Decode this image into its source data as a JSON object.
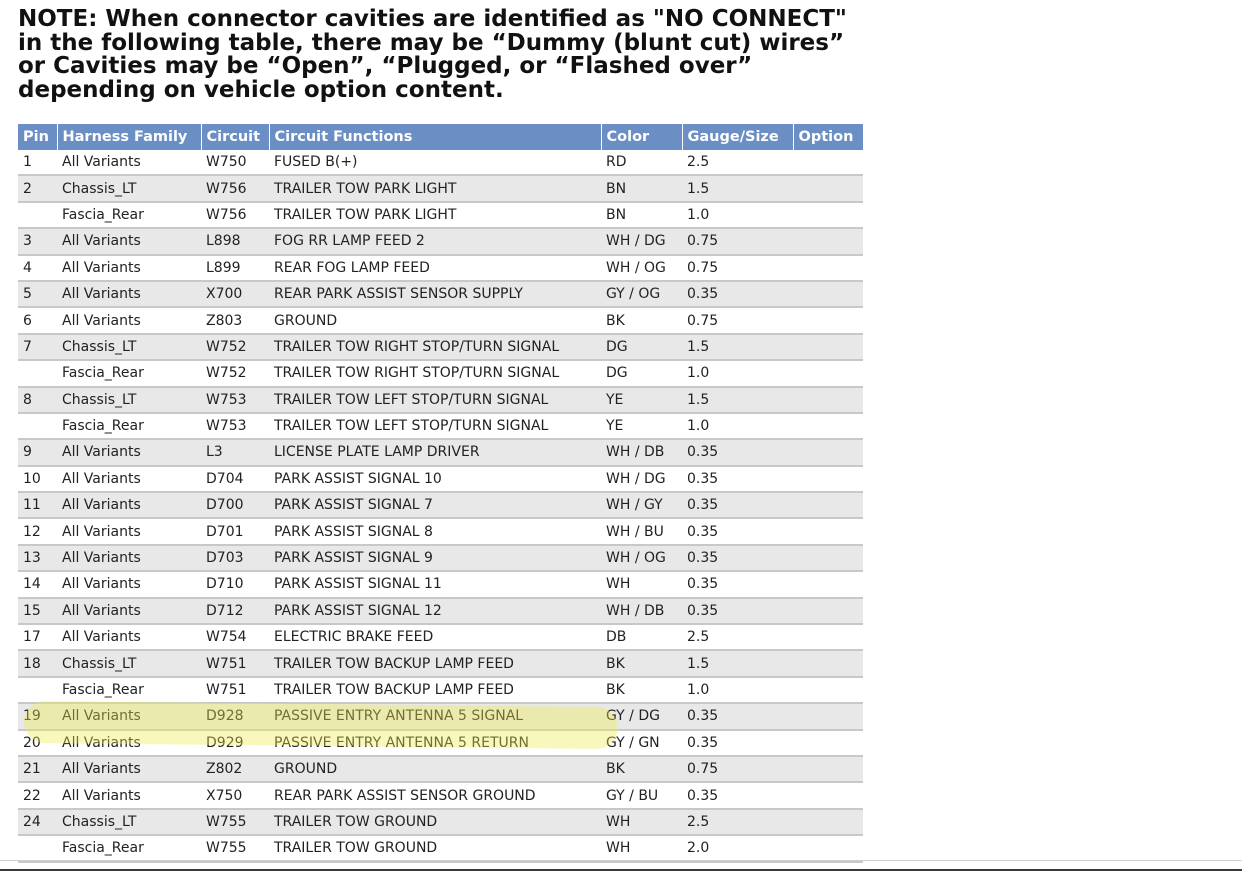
{
  "note": {
    "lines": [
      "NOTE: When connector cavities are identified as \"NO CONNECT\"",
      "in the following table, there may be “Dummy (blunt cut) wires”",
      "or Cavities may be “Open”, “Plugged, or “Flashed over”",
      "depending on vehicle option content."
    ]
  },
  "table": {
    "headers": [
      "Pin",
      "Harness Family",
      "Circuit",
      "Circuit Functions",
      "Color",
      "Gauge/Size",
      "Option"
    ],
    "rows": [
      [
        "1",
        "All Variants",
        "W750",
        "FUSED B(+)",
        "RD",
        "2.5",
        ""
      ],
      [
        "2",
        "Chassis_LT",
        "W756",
        "TRAILER TOW PARK LIGHT",
        "BN",
        "1.5",
        ""
      ],
      [
        "",
        "Fascia_Rear",
        "W756",
        "TRAILER TOW PARK LIGHT",
        "BN",
        "1.0",
        ""
      ],
      [
        "3",
        "All Variants",
        "L898",
        "FOG RR LAMP FEED 2",
        "WH / DG",
        "0.75",
        ""
      ],
      [
        "4",
        "All Variants",
        "L899",
        "REAR FOG LAMP FEED",
        "WH / OG",
        "0.75",
        ""
      ],
      [
        "5",
        "All Variants",
        "X700",
        "REAR PARK ASSIST SENSOR SUPPLY",
        "GY / OG",
        "0.35",
        ""
      ],
      [
        "6",
        "All Variants",
        "Z803",
        "GROUND",
        "BK",
        "0.75",
        ""
      ],
      [
        "7",
        "Chassis_LT",
        "W752",
        "TRAILER TOW RIGHT STOP/TURN SIGNAL",
        "DG",
        "1.5",
        ""
      ],
      [
        "",
        "Fascia_Rear",
        "W752",
        "TRAILER TOW RIGHT STOP/TURN SIGNAL",
        "DG",
        "1.0",
        ""
      ],
      [
        "8",
        "Chassis_LT",
        "W753",
        "TRAILER TOW LEFT STOP/TURN SIGNAL",
        "YE",
        "1.5",
        ""
      ],
      [
        "",
        "Fascia_Rear",
        "W753",
        "TRAILER TOW LEFT STOP/TURN SIGNAL",
        "YE",
        "1.0",
        ""
      ],
      [
        "9",
        "All Variants",
        "L3",
        "LICENSE PLATE LAMP DRIVER",
        "WH / DB",
        "0.35",
        ""
      ],
      [
        "10",
        "All Variants",
        "D704",
        "PARK ASSIST SIGNAL 10",
        "WH / DG",
        "0.35",
        ""
      ],
      [
        "11",
        "All Variants",
        "D700",
        "PARK ASSIST SIGNAL 7",
        "WH / GY",
        "0.35",
        ""
      ],
      [
        "12",
        "All Variants",
        "D701",
        "PARK ASSIST SIGNAL 8",
        "WH / BU",
        "0.35",
        ""
      ],
      [
        "13",
        "All Variants",
        "D703",
        "PARK ASSIST SIGNAL 9",
        "WH / OG",
        "0.35",
        ""
      ],
      [
        "14",
        "All Variants",
        "D710",
        "PARK ASSIST SIGNAL 11",
        "WH",
        "0.35",
        ""
      ],
      [
        "15",
        "All Variants",
        "D712",
        "PARK ASSIST SIGNAL 12",
        "WH / DB",
        "0.35",
        ""
      ],
      [
        "17",
        "All Variants",
        "W754",
        "ELECTRIC BRAKE FEED",
        "DB",
        "2.5",
        ""
      ],
      [
        "18",
        "Chassis_LT",
        "W751",
        "TRAILER TOW BACKUP LAMP FEED",
        "BK",
        "1.5",
        ""
      ],
      [
        "",
        "Fascia_Rear",
        "W751",
        "TRAILER TOW BACKUP LAMP FEED",
        "BK",
        "1.0",
        ""
      ],
      [
        "19",
        "All Variants",
        "D928",
        "PASSIVE ENTRY ANTENNA 5 SIGNAL",
        "GY / DG",
        "0.35",
        ""
      ],
      [
        "20",
        "All Variants",
        "D929",
        "PASSIVE ENTRY ANTENNA 5 RETURN",
        "GY / GN",
        "0.35",
        ""
      ],
      [
        "21",
        "All Variants",
        "Z802",
        "GROUND",
        "BK",
        "0.75",
        ""
      ],
      [
        "22",
        "All Variants",
        "X750",
        "REAR PARK ASSIST SENSOR GROUND",
        "GY / BU",
        "0.35",
        ""
      ],
      [
        "24",
        "Chassis_LT",
        "W755",
        "TRAILER TOW GROUND",
        "WH",
        "2.5",
        ""
      ],
      [
        "",
        "Fascia_Rear",
        "W755",
        "TRAILER TOW GROUND",
        "WH",
        "2.0",
        ""
      ]
    ]
  },
  "colors": {
    "header_bg": "#6b8fc4",
    "row_alt_bg": "#e8e8e8",
    "highlight": "#f0ec50"
  }
}
